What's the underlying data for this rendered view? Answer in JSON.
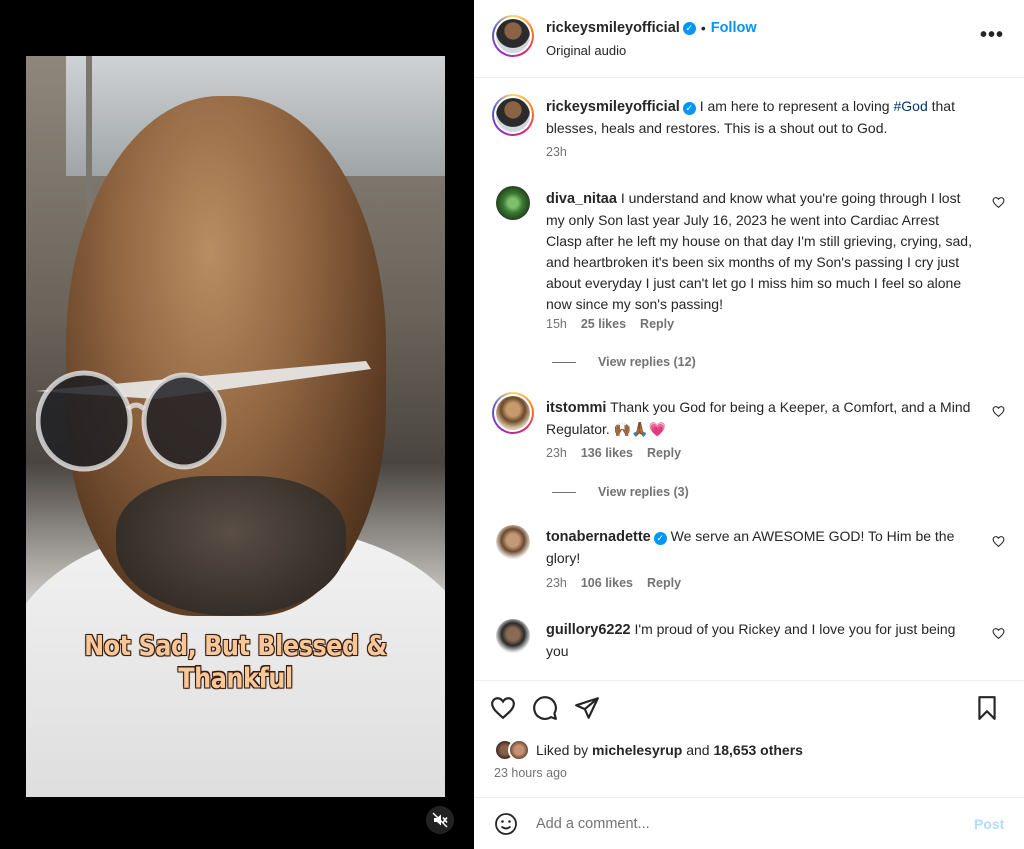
{
  "video": {
    "caption": "Not Sad, But Blessed & Thankful",
    "mute_icon": "muted-speaker-icon"
  },
  "header": {
    "username": "rickeysmileyofficial",
    "verified": true,
    "separator": "•",
    "follow_label": "Follow",
    "subtitle": "Original audio",
    "more_label": "•••"
  },
  "caption_post": {
    "username": "rickeysmileyofficial",
    "text_before": "I am here to represent a loving ",
    "hashtag": "#God",
    "text_after": " that blesses, heals and restores. This is a shout out to God.",
    "time": "23h"
  },
  "comments": [
    {
      "username": "diva_nitaa",
      "text": "I understand and know what you're going through I lost my only Son last year July 16, 2023 he went into Cardiac Arrest Clasp after he left my house on that day I'm still grieving, crying, sad, and heartbroken it's been six months of my Son's passing I cry just about everyday I just can't let go I miss him so much I feel so alone now since my son's passing!",
      "time": "15h",
      "likes": "25 likes",
      "reply": "Reply",
      "view_replies": "View replies (12)"
    },
    {
      "username": "itstommi",
      "text": "Thank you God for being a Keeper, a Comfort, and a Mind Regulator. 🙌🏾🙏🏾💗",
      "time": "23h",
      "likes": "136 likes",
      "reply": "Reply",
      "view_replies": "View replies (3)"
    },
    {
      "username": "tonabernadette",
      "verified": true,
      "text": "We serve an AWESOME GOD! To Him be the glory!",
      "time": "23h",
      "likes": "106 likes",
      "reply": "Reply"
    },
    {
      "username": "guillory6222",
      "text": "I'm proud of you Rickey and I love you for just being you"
    }
  ],
  "actions": {
    "like_icon": "heart-icon",
    "comment_icon": "comment-bubble-icon",
    "share_icon": "paper-plane-icon",
    "save_icon": "bookmark-icon",
    "liked_by_prefix": "Liked by",
    "liked_by_user": "michelesyrup",
    "liked_by_and": "and",
    "liked_by_others": "18,653 others",
    "timestamp": "23 hours ago"
  },
  "composer": {
    "placeholder": "Add a comment...",
    "post_label": "Post",
    "emoji_icon": "smiley-icon"
  },
  "colors": {
    "accent": "#0095f6",
    "post_disabled": "#b3dbff",
    "muted_text": "#737373",
    "hashtag": "#00376b"
  }
}
